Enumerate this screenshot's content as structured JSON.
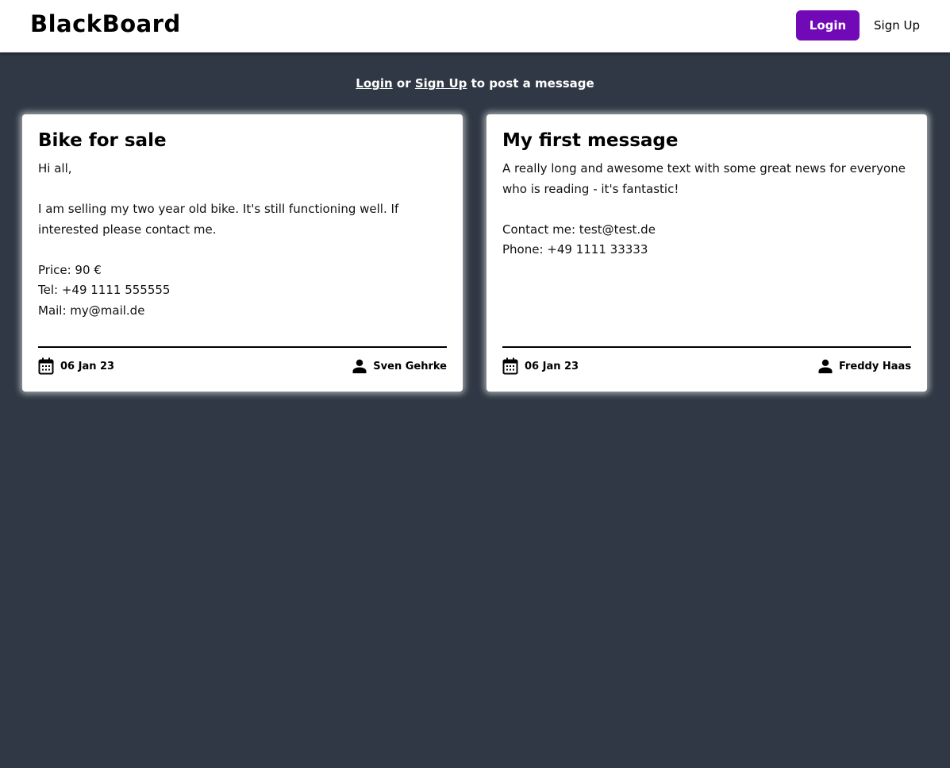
{
  "header": {
    "brand": "BlackBoard",
    "login_label": "Login",
    "signup_label": "Sign Up",
    "accent_color": "#7209b7"
  },
  "notice": {
    "login_link": "Login",
    "or_text": "or",
    "signup_link": "Sign Up",
    "suffix": "to post a message"
  },
  "posts": [
    {
      "title": "Bike for sale",
      "body": "Hi all,\n\nI am selling my two year old bike. It's still functioning well. If interested please contact me.\n\nPrice: 90 €\nTel: +49 1111 555555\nMail: my@mail.de",
      "date": "06 Jan 23",
      "author": "Sven Gehrke",
      "date_icon": "calendar-icon",
      "author_icon": "user-icon"
    },
    {
      "title": "My first message",
      "body": "A really long and awesome text with some great news for everyone who is reading - it's fantastic!\n\nContact me: test@test.de\nPhone: +49 1111 33333",
      "date": "06 Jan 23",
      "author": "Freddy Haas",
      "date_icon": "calendar-icon",
      "author_icon": "user-icon"
    }
  ]
}
